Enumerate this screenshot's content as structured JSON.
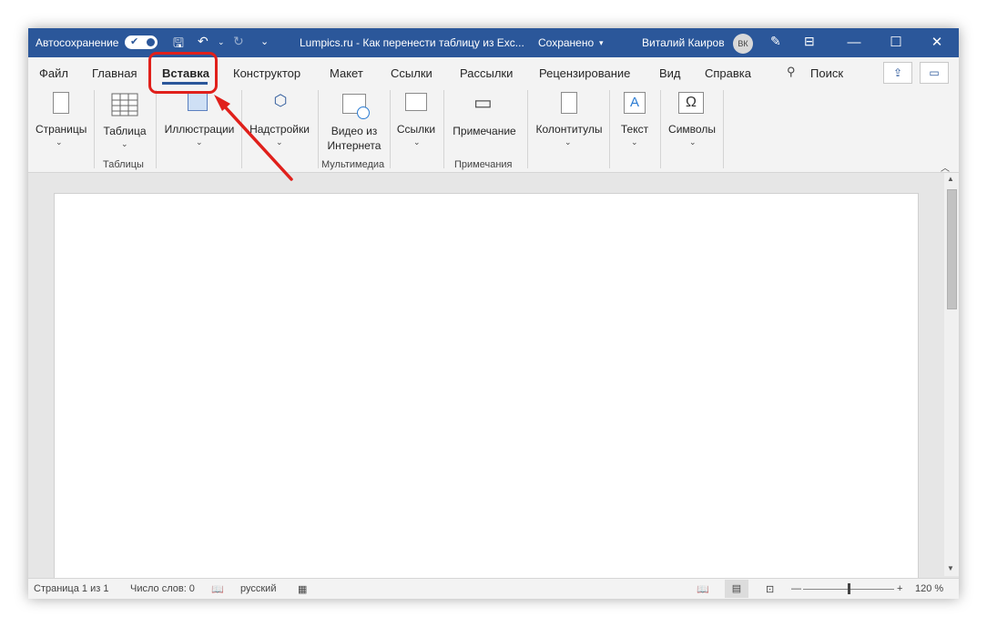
{
  "titlebar": {
    "autosave_label": "Автосохранение",
    "doc_title": "Lumpics.ru - Как перенести таблицу из Exc...",
    "save_status": "Сохранено",
    "user_name": "Виталий Каиров",
    "user_initials": "ВК",
    "accent_color": "#2b579a"
  },
  "tabs": [
    {
      "label": "Файл"
    },
    {
      "label": "Главная"
    },
    {
      "label": "Вставка",
      "active": true
    },
    {
      "label": "Конструктор"
    },
    {
      "label": "Макет"
    },
    {
      "label": "Ссылки"
    },
    {
      "label": "Рассылки"
    },
    {
      "label": "Рецензирование"
    },
    {
      "label": "Вид"
    },
    {
      "label": "Справка"
    }
  ],
  "search": {
    "label": "Поиск"
  },
  "ribbon": {
    "buttons": {
      "pages": "Страницы",
      "table": "Таблица",
      "illustrations": "Иллюстрации",
      "addins": "Надстройки",
      "video_line1": "Видео из",
      "video_line2": "Интернета",
      "links": "Ссылки",
      "comment": "Примечание",
      "headers": "Колонтитулы",
      "text": "Текст",
      "symbols": "Символы"
    },
    "groups": {
      "tables": "Таблицы",
      "media": "Мультимедиа",
      "comments": "Примечания"
    }
  },
  "statusbar": {
    "page": "Страница 1 из 1",
    "words": "Число слов: 0",
    "language": "русский",
    "zoom": "120 %"
  },
  "annotation": {
    "color": "#e0201b"
  }
}
